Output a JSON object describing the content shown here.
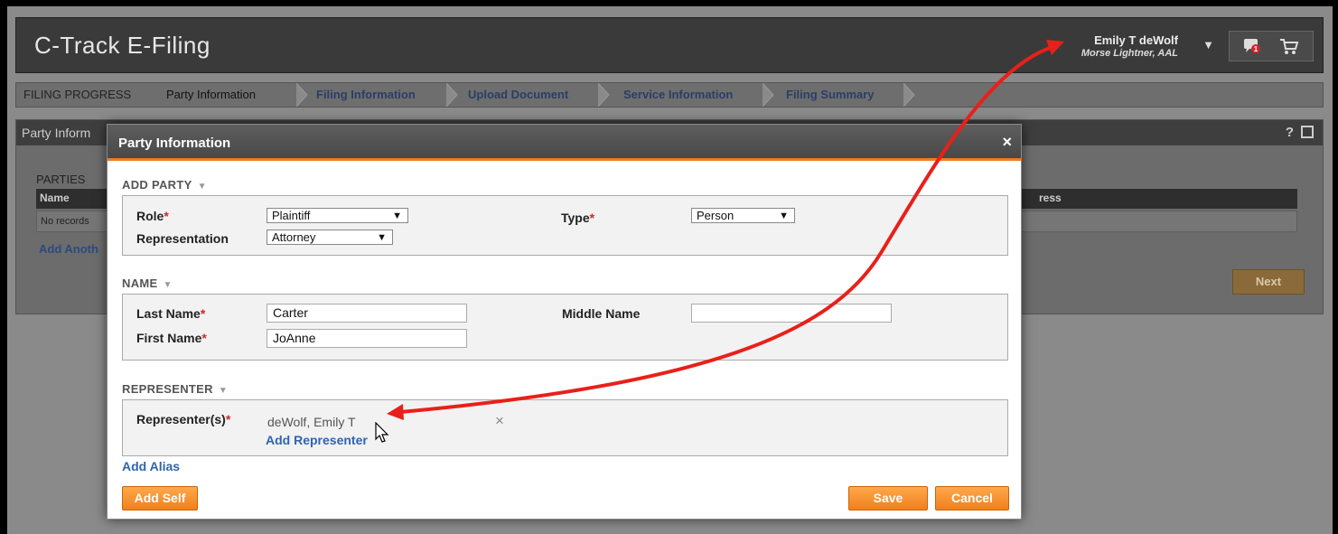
{
  "app": {
    "title": "C-Track E-Filing"
  },
  "user": {
    "name": "Emily T deWolf",
    "org": "Morse Lightner, AAL",
    "notification_count": "1"
  },
  "progress": {
    "label": "FILING PROGRESS",
    "steps": [
      "Party Information",
      "Filing Information",
      "Upload Document",
      "Service Information",
      "Filing Summary"
    ]
  },
  "background": {
    "panel_title": "Party Inform",
    "help": "?",
    "parties_label": "PARTIES",
    "col_name": "Name",
    "col_address": "ress",
    "no_records": "No records",
    "add_another": "Add Anoth",
    "next": "Next"
  },
  "modal": {
    "title": "Party Information",
    "close": "×",
    "add_party": {
      "section_title": "ADD PARTY",
      "role_label": "Role",
      "role_value": "Plaintiff",
      "type_label": "Type",
      "type_value": "Person",
      "representation_label": "Representation",
      "representation_value": "Attorney"
    },
    "name": {
      "section_title": "NAME",
      "last_name_label": "Last Name",
      "last_name_value": "Carter",
      "middle_name_label": "Middle Name",
      "middle_name_value": "",
      "first_name_label": "First Name",
      "first_name_value": "JoAnne"
    },
    "representer": {
      "section_title": "REPRESENTER",
      "label": "Representer(s)",
      "value": "deWolf, Emily T",
      "remove": "×",
      "add_link": "Add Representer"
    },
    "add_alias": "Add Alias",
    "buttons": {
      "add_self": "Add Self",
      "save": "Save",
      "cancel": "Cancel"
    }
  },
  "required_marker": "*",
  "colors": {
    "accent": "#f07c1e",
    "link": "#2e64b0",
    "annotation_arrow": "#e8201a"
  }
}
